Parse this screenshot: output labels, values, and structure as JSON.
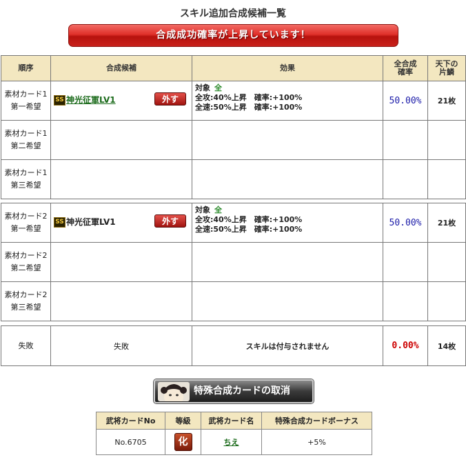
{
  "page_title": "スキル追加合成候補一覧",
  "banner": "合成成功確率が上昇しています！",
  "headers": {
    "seq": "順序",
    "candidate": "合成候補",
    "effect": "効果",
    "total_rate": "全合成確率",
    "piece": "天下の片鱗"
  },
  "groups": [
    {
      "rows": [
        {
          "seq1": "素材カード1",
          "seq2": "第一希望",
          "skill": "神光征軍LV1",
          "remove": "外す",
          "target_label": "対象",
          "target_value": "全",
          "effect1": "全攻:40%上昇　確率:+100%",
          "effect2": "全速:50%上昇　確率:+100%",
          "rate": "50.00%",
          "count": "21枚"
        },
        {
          "seq1": "素材カード1",
          "seq2": "第二希望"
        },
        {
          "seq1": "素材カード1",
          "seq2": "第三希望"
        }
      ]
    },
    {
      "rows": [
        {
          "seq1": "素材カード2",
          "seq2": "第一希望",
          "skill": "神光征軍LV1",
          "remove": "外す",
          "target_label": "対象",
          "target_value": "全",
          "effect1": "全攻:40%上昇　確率:+100%",
          "effect2": "全速:50%上昇　確率:+100%",
          "rate": "50.00%",
          "count": "21枚"
        },
        {
          "seq1": "素材カード2",
          "seq2": "第二希望"
        },
        {
          "seq1": "素材カード2",
          "seq2": "第三希望"
        }
      ]
    }
  ],
  "fail_row": {
    "seq": "失敗",
    "candidate": "失敗",
    "effect": "スキルは付与されません",
    "rate": "0.00%",
    "count": "14枚"
  },
  "cancel_button": "特殊合成カードの取消",
  "bonus_table": {
    "headers": [
      "武将カードNo",
      "等級",
      "武将カード名",
      "特殊合成カードボーナス"
    ],
    "row": {
      "no": "No.6705",
      "rank": "化",
      "name": "ちえ",
      "bonus": "+5%"
    }
  },
  "colors": {
    "banner": "#e0302a",
    "header_bg": "#f3e7c0",
    "rate_blue": "#1a1aa8",
    "rate_red": "#cc0000",
    "link_green": "#1a6a1a"
  }
}
